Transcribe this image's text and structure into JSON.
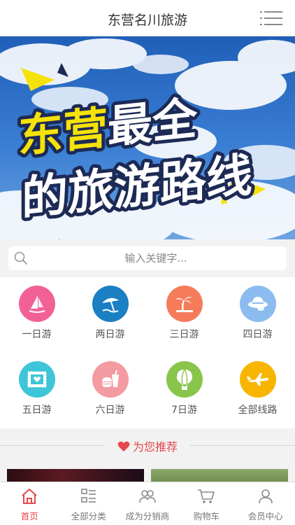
{
  "header": {
    "title": "东营名川旅游",
    "menu_icon": "hamburger-menu-icon"
  },
  "banner": {
    "line1_yellow": "东营",
    "line1_white": "最全",
    "line2": "的旅游路线"
  },
  "search": {
    "placeholder": "输入关键字..."
  },
  "categories": [
    {
      "label": "一日游",
      "icon": "windsurf-icon",
      "color": "#f26196"
    },
    {
      "label": "两日游",
      "icon": "beach-umbrella-icon",
      "color": "#1b7fc4"
    },
    {
      "label": "三日游",
      "icon": "palm-tree-icon",
      "color": "#f47c5b"
    },
    {
      "label": "四日游",
      "icon": "sun-hat-icon",
      "color": "#8cbcef"
    },
    {
      "label": "五日游",
      "icon": "stamp-icon",
      "color": "#3fc5d8"
    },
    {
      "label": "六日游",
      "icon": "food-drink-icon",
      "color": "#f49aa1"
    },
    {
      "label": "7日游",
      "icon": "hot-air-balloon-icon",
      "color": "#8ac54b"
    },
    {
      "label": "全部线路",
      "icon": "airplane-icon",
      "color": "#f7b500"
    }
  ],
  "recommend": {
    "title": "为您推荐",
    "accent": "#e5484d"
  },
  "tabbar": [
    {
      "label": "首页",
      "icon": "home-icon",
      "active": true
    },
    {
      "label": "全部分类",
      "icon": "category-list-icon",
      "active": false
    },
    {
      "label": "成为分销商",
      "icon": "distributor-icon",
      "active": false
    },
    {
      "label": "购物车",
      "icon": "shopping-cart-icon",
      "active": false
    },
    {
      "label": "会员中心",
      "icon": "user-icon",
      "active": false
    }
  ]
}
